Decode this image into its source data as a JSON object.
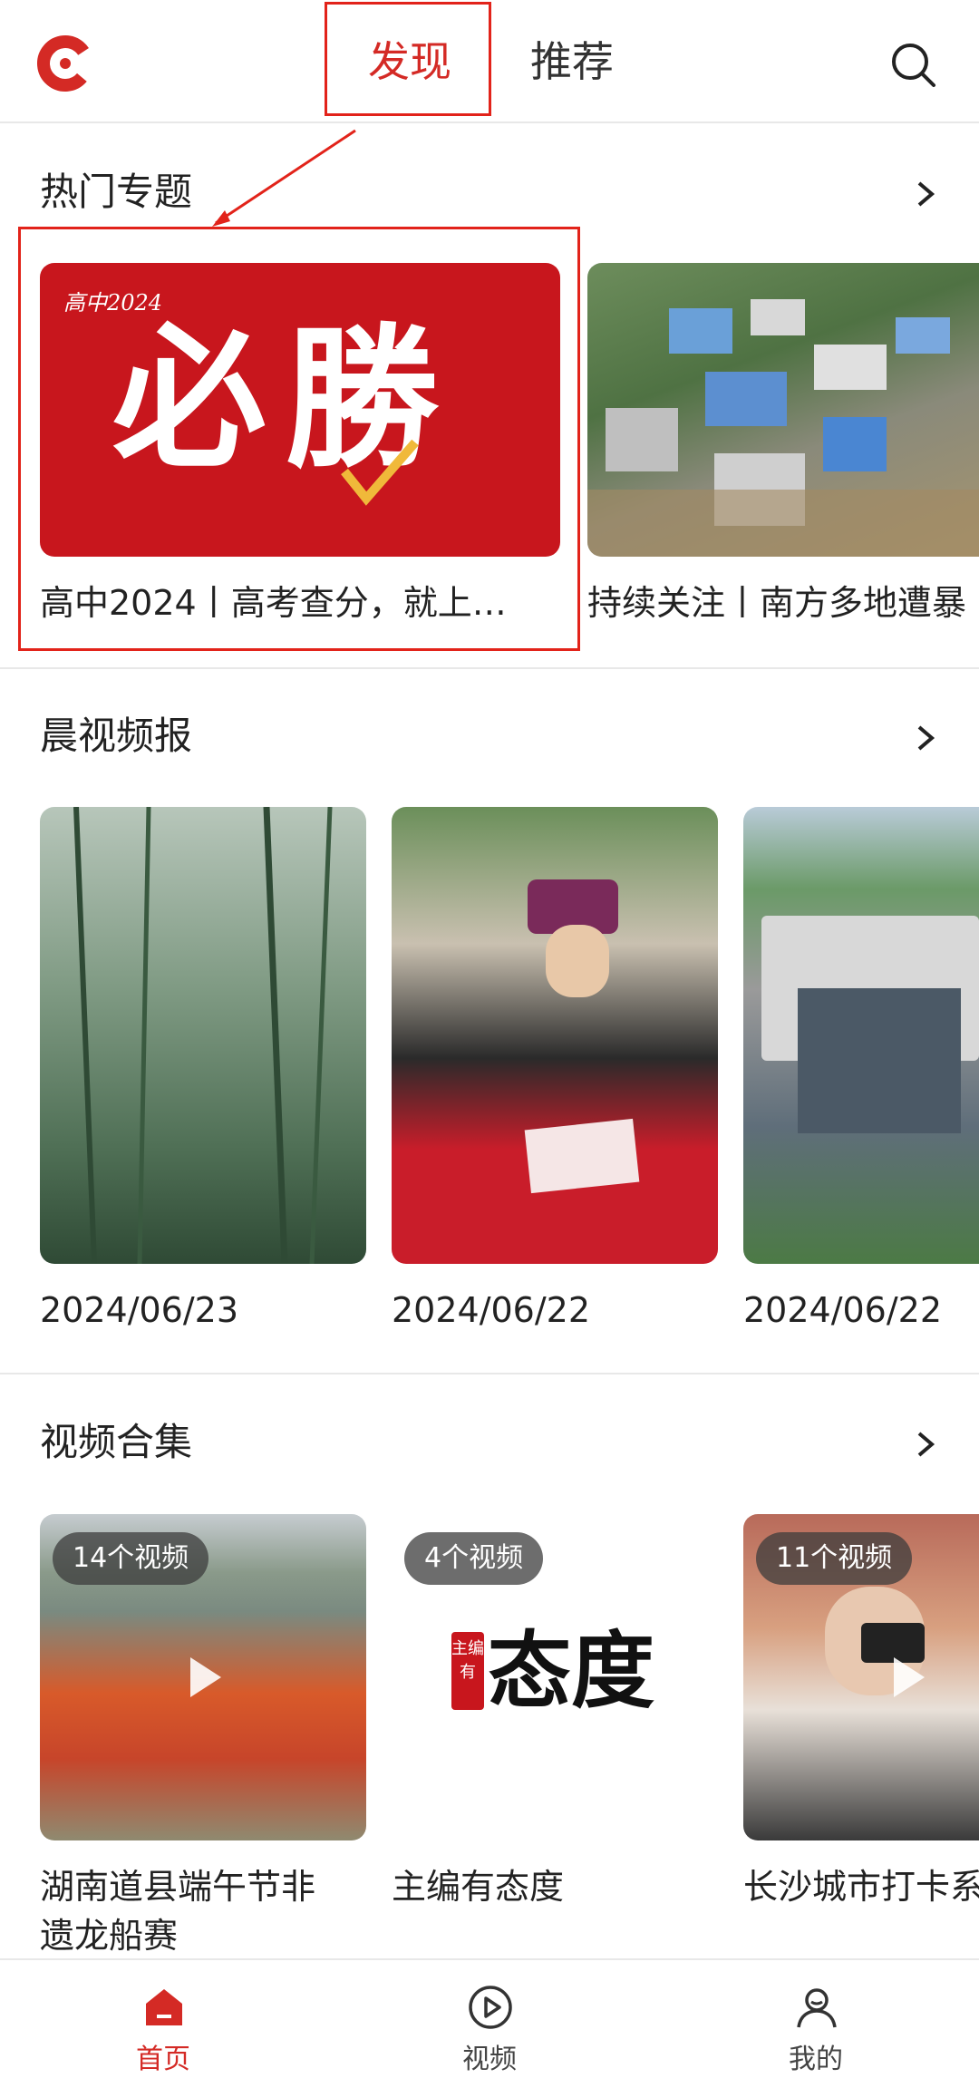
{
  "header": {
    "tabs": [
      {
        "label": "发现",
        "active": true
      },
      {
        "label": "推荐",
        "active": false
      }
    ],
    "search_icon": "search-icon",
    "brand_color": "#d42a25"
  },
  "hot_topics": {
    "title": "热门专题",
    "cards": [
      {
        "image_label": "必勝",
        "image_sublabel": "高中2024",
        "caption": "高中2024丨高考查分，就上…"
      },
      {
        "image_label": "",
        "caption": "持续关注丨南方多地遭暴"
      }
    ]
  },
  "morning_video": {
    "title": "晨视频报",
    "items": [
      {
        "date": "2024/06/23"
      },
      {
        "date": "2024/06/22"
      },
      {
        "date": "2024/06/22"
      }
    ]
  },
  "video_collection": {
    "title": "视频合集",
    "items": [
      {
        "badge": "14个视频",
        "caption_line1": "湖南道县端午节非",
        "caption_line2": "遗龙船赛"
      },
      {
        "badge": "4个视频",
        "logo_small": "主编有",
        "logo_big": "态度",
        "caption_line1": "主编有态度",
        "caption_line2": ""
      },
      {
        "badge": "11个视频",
        "caption_line1": "长沙城市打卡系",
        "caption_line2": ""
      }
    ]
  },
  "bottom_nav": {
    "items": [
      {
        "label": "首页",
        "icon": "home-icon",
        "active": true
      },
      {
        "label": "视频",
        "icon": "video-play-icon",
        "active": false
      },
      {
        "label": "我的",
        "icon": "profile-icon",
        "active": false
      }
    ]
  }
}
